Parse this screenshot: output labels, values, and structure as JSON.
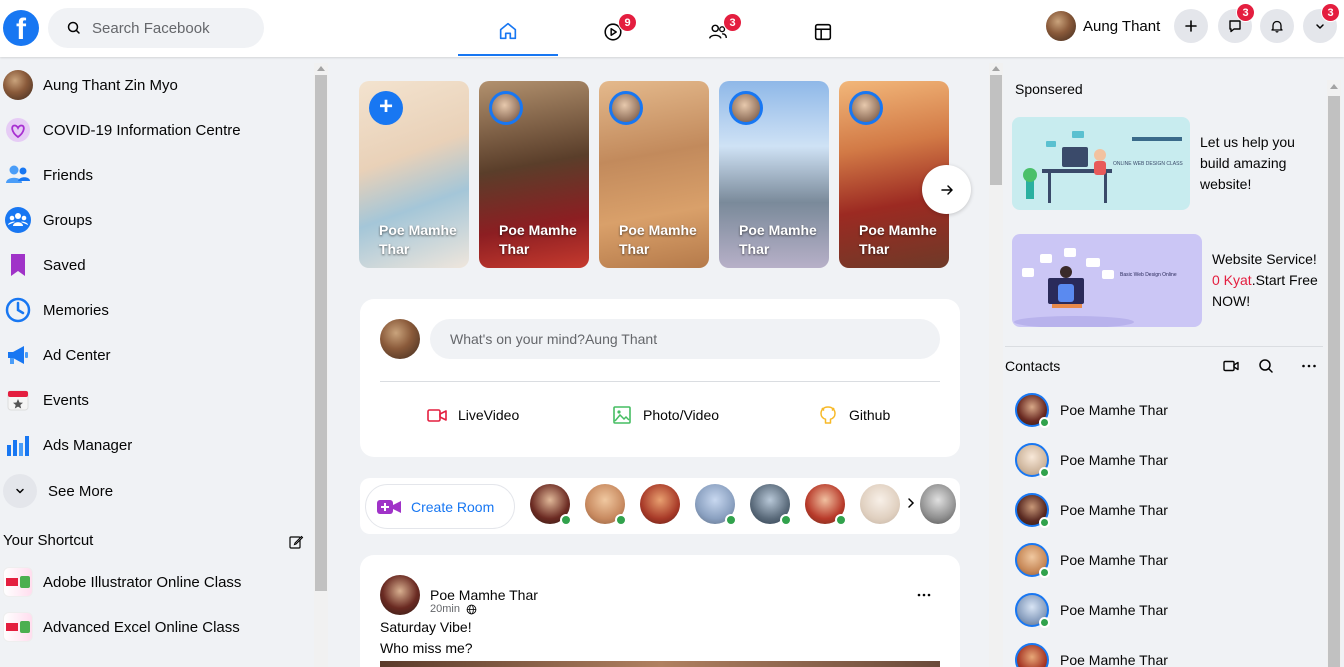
{
  "header": {
    "logo_letter": "f",
    "search_placeholder": "Search Facebook",
    "nav": [
      {
        "name": "home",
        "badge": ""
      },
      {
        "name": "watch",
        "badge": "9"
      },
      {
        "name": "friends",
        "badge": "3"
      },
      {
        "name": "marketplace",
        "badge": ""
      }
    ],
    "profile_name": "Aung Thant",
    "account_badge": "3",
    "messenger_badge": "3",
    "accent_color": "#1877f2",
    "badge_color": "#e41e3f"
  },
  "sidebar": {
    "items": [
      {
        "label": "Aung Thant Zin Myo",
        "icon": "profile-avatar"
      },
      {
        "label": "COVID-19 Information Centre",
        "icon": "covid-heart-icon"
      },
      {
        "label": "Friends",
        "icon": "friends-icon"
      },
      {
        "label": "Groups",
        "icon": "groups-icon"
      },
      {
        "label": "Saved",
        "icon": "bookmark-icon"
      },
      {
        "label": "Memories",
        "icon": "clock-icon"
      },
      {
        "label": "Ad Center",
        "icon": "megaphone-icon"
      },
      {
        "label": "Events",
        "icon": "calendar-star-icon"
      },
      {
        "label": "Ads Manager",
        "icon": "bar-chart-icon"
      }
    ],
    "see_more": "See More",
    "shortcut_title": "Your Shortcut",
    "shortcuts": [
      "Adobe Illustrator Online Class",
      "Advanced Excel Online Class"
    ]
  },
  "stories": {
    "items": [
      {
        "name": "Poe Mamhe Thar"
      },
      {
        "name": "Poe Mamhe Thar"
      },
      {
        "name": "Poe Mamhe Thar"
      },
      {
        "name": "Poe Mamhe Thar"
      },
      {
        "name": "Poe Mamhe Thar"
      }
    ]
  },
  "composer": {
    "placeholder": "What's on your mind?Aung Thant",
    "actions": [
      "LiveVideo",
      "Photo/Video",
      "Github"
    ]
  },
  "rooms": {
    "create_label": "Create Room"
  },
  "post": {
    "author": "Poe Mamhe Thar",
    "time": "20min",
    "line1": "Saturday Vibe!",
    "line2": "Who miss me?"
  },
  "right": {
    "sponsored_title": "Sponsered",
    "ad1_text": "Let us help you build amazing website!",
    "ad1_image_text": "ONLINE WEB DESIGN CLASS",
    "ad2_line1": "Website Service!",
    "ad2_red": "0 Kyat",
    "ad2_rest": ".Start Free NOW!",
    "ad2_image_text": "Basic Web Design Online",
    "contacts_title": "Contacts",
    "contacts": [
      "Poe Mamhe Thar",
      "Poe Mamhe Thar",
      "Poe Mamhe Thar",
      "Poe Mamhe Thar",
      "Poe Mamhe Thar",
      "Poe Mamhe Thar"
    ]
  }
}
